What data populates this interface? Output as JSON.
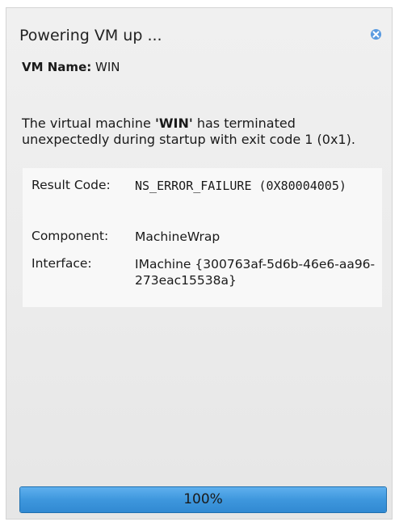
{
  "dialog": {
    "title": "Powering VM up ...",
    "close_icon": "close-icon",
    "vm_name_label": "VM Name:",
    "vm_name_value": "WIN"
  },
  "message": {
    "prefix": "The virtual machine ",
    "vm_name": "'WIN'",
    "suffix": " has terminated unexpectedly during startup with exit code 1 (0x1)."
  },
  "details": {
    "result_code_label": "Result Code:",
    "result_code_value": "NS_ERROR_FAILURE (0X80004005)",
    "component_label": "Component:",
    "component_value": "MachineWrap",
    "interface_label": "Interface:",
    "interface_value": "IMachine {300763af-5d6b-46e6-aa96-273eac15538a}"
  },
  "progress": {
    "percent": 100,
    "text": "100%"
  },
  "colors": {
    "progress_fill": "#3e97dd",
    "close_icon": "#5a9be0"
  }
}
